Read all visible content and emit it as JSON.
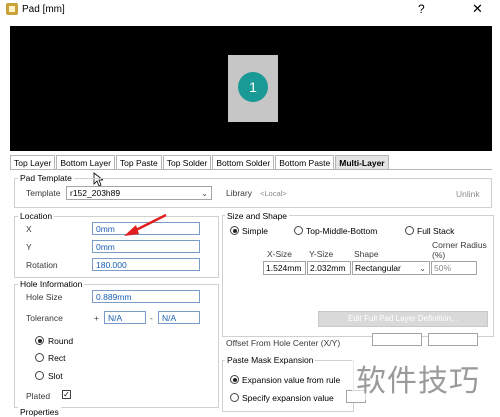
{
  "window": {
    "title": "Pad [mm]",
    "help": "?",
    "close": "✕"
  },
  "preview": {
    "pad_number": "1"
  },
  "tabs": [
    "Top Layer",
    "Bottom Layer",
    "Top Paste",
    "Top Solder",
    "Bottom Solder",
    "Bottom Paste",
    "Multi-Layer"
  ],
  "pad_template": {
    "group": "Pad Template",
    "template_label": "Template",
    "template_value": "r152_203h89",
    "library_label": "Library",
    "library_value": "<Local>",
    "unlink": "Unlink"
  },
  "location": {
    "group": "Location",
    "x_label": "X",
    "x_value": "0mm",
    "y_label": "Y",
    "y_value": "0mm",
    "rotation_label": "Rotation",
    "rotation_value": "180.000"
  },
  "hole": {
    "group": "Hole Information",
    "size_label": "Hole Size",
    "size_value": "0.889mm",
    "tolerance_label": "Tolerance",
    "plus": "+",
    "plus_value": "N/A",
    "minus": "-",
    "minus_value": "N/A",
    "round": "Round",
    "rect": "Rect",
    "slot": "Slot",
    "plated": "Plated"
  },
  "size_shape": {
    "group": "Size and Shape",
    "simple": "Simple",
    "tmb": "Top-Middle-Bottom",
    "full": "Full Stack",
    "col_x": "X-Size",
    "col_y": "Y-Size",
    "col_shape": "Shape",
    "col_radius": "Corner Radius (%)",
    "x_size": "1.524mm",
    "y_size": "2.032mm",
    "shape": "Rectangular",
    "radius": "50%",
    "edit_button": "Edit Full Pad Layer Definition..."
  },
  "offset": {
    "label": "Offset From Hole Center (X/Y)"
  },
  "paste": {
    "group": "Paste Mask Expansion",
    "opt1": "Expansion value from rule",
    "opt2": "Specify expansion value"
  },
  "properties": {
    "group": "Properties"
  },
  "watermark": "软件技巧"
}
